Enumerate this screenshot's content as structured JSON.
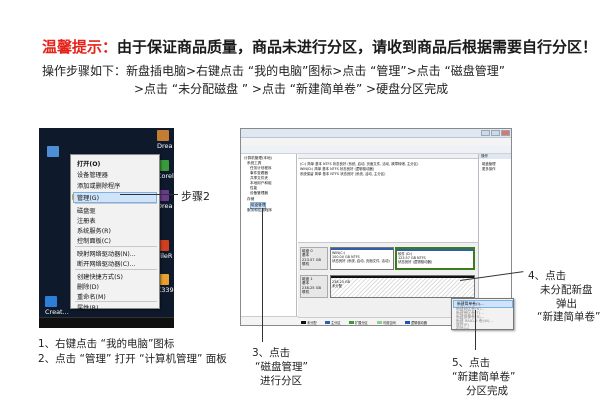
{
  "header": {
    "notice_label": "温馨提示：",
    "notice_text": "由于保证商品质量，商品未进行分区，请收到商品后根据需要自行分区！",
    "steps_line1": "操作步骤如下：新盘插电脑>右键点击 “我的电脑”图标>点击 “管理”>点击 “磁盘管理”",
    "steps_line2": ">点击 “未分配磁盘 ” >点击 “新建简单卷” >硬盘分区完成"
  },
  "desktop": {
    "icon_labels": [
      "Drea",
      "Corel",
      "Drea",
      "FileR",
      "K339",
      "Creat..."
    ],
    "context_menu": {
      "items": [
        "打开(O)",
        "设备管理器",
        "添加或删除程序",
        "管理(G)",
        "磁盘驱",
        "注册表",
        "系统服务(R)",
        "控制面板(C)",
        "映射网络驱动器(N)...",
        "断开网络驱动器(C)...",
        "创建快捷方式(S)",
        "删除(D)",
        "重命名(M)",
        "属性(R)"
      ],
      "selected": "管理(G)"
    }
  },
  "annotations": {
    "step2": "步骤2",
    "caption1": "1、右键点击 “我的电脑”图标",
    "caption2": "2、点击 “管理” 打开 “计算机管理” 面板",
    "step3_line1": "3、点击",
    "step3_line2": "“磁盘管理”",
    "step3_line3": "进行分区",
    "step4_line1": "4、点击",
    "step4_line2": "未分配新盘",
    "step4_line3": "弹出",
    "step4_line4": "“新建简单卷”",
    "step5_line1": "5、点击",
    "step5_line2": "“新建简单卷”",
    "step5_line3": "分区完成"
  },
  "computer_management": {
    "tree": [
      "计算机管理(本地)",
      "系统工具",
      "任务计划程序",
      "事件查看器",
      "共享文件夹",
      "本地用户和组",
      "性能",
      "设备管理器",
      "存储",
      "磁盘管理",
      "服务和应用程序"
    ],
    "tree_selected": "磁盘管理",
    "volume_rows": [
      [
        "(C:)",
        "简单",
        "基本",
        "NTFS",
        "状态良好 (系统, 启动, 页面文件, 活动, 故障转储, 主分区)"
      ],
      [
        "WIN(D:)",
        "简单",
        "基本",
        "NTFS",
        "状态良好 (逻辑驱动器)"
      ],
      [
        "系统保留",
        "简单",
        "基本",
        "NTFS",
        "状态良好 (系统, 活动, 主分区)"
      ]
    ],
    "disks": [
      {
        "label": "磁盘 0",
        "type": "基本",
        "size": "223.57 GB",
        "status": "联机",
        "partitions": [
          {
            "name": "WIN(C:)",
            "size": "100.00 GB NTFS",
            "status": "状态良好 (系统, 启动, 页面文件, 活动)"
          },
          {
            "name": "软件 (D:)",
            "size": "123.57 GB NTFS",
            "status": "状态良好 (逻辑驱动器)"
          }
        ]
      },
      {
        "label": "磁盘 1",
        "type": "基本",
        "size": "238.25 GB",
        "status": "联机",
        "partitions": [
          {
            "name": "",
            "size": "238.25 GB",
            "status": "未分配"
          }
        ]
      }
    ],
    "actions_title": "操作",
    "actions": [
      "磁盘管理",
      "更多操作"
    ],
    "legend": [
      {
        "label": "未分配",
        "color": "#111111"
      },
      {
        "label": "主分区",
        "color": "#2f5fa8"
      },
      {
        "label": "扩展分区",
        "color": "#3b9a3b"
      },
      {
        "label": "可用空间",
        "color": "#8bd18b"
      },
      {
        "label": "逻辑驱动器",
        "color": "#2050b8"
      }
    ],
    "popup_menu": {
      "items": [
        "新建简单卷(I)...",
        "新建跨区卷(N)...",
        "新建带区卷(T)...",
        "新建镜像卷(R)...",
        "新建 RAID-5 卷(W)...",
        "属性(P)",
        "帮助(H)"
      ],
      "selected": "新建简单卷(I)..."
    }
  },
  "colors": {
    "notice_red": "#e5231b",
    "selection": "#cfe4fa",
    "primary_partition": "#2f5fa8"
  }
}
